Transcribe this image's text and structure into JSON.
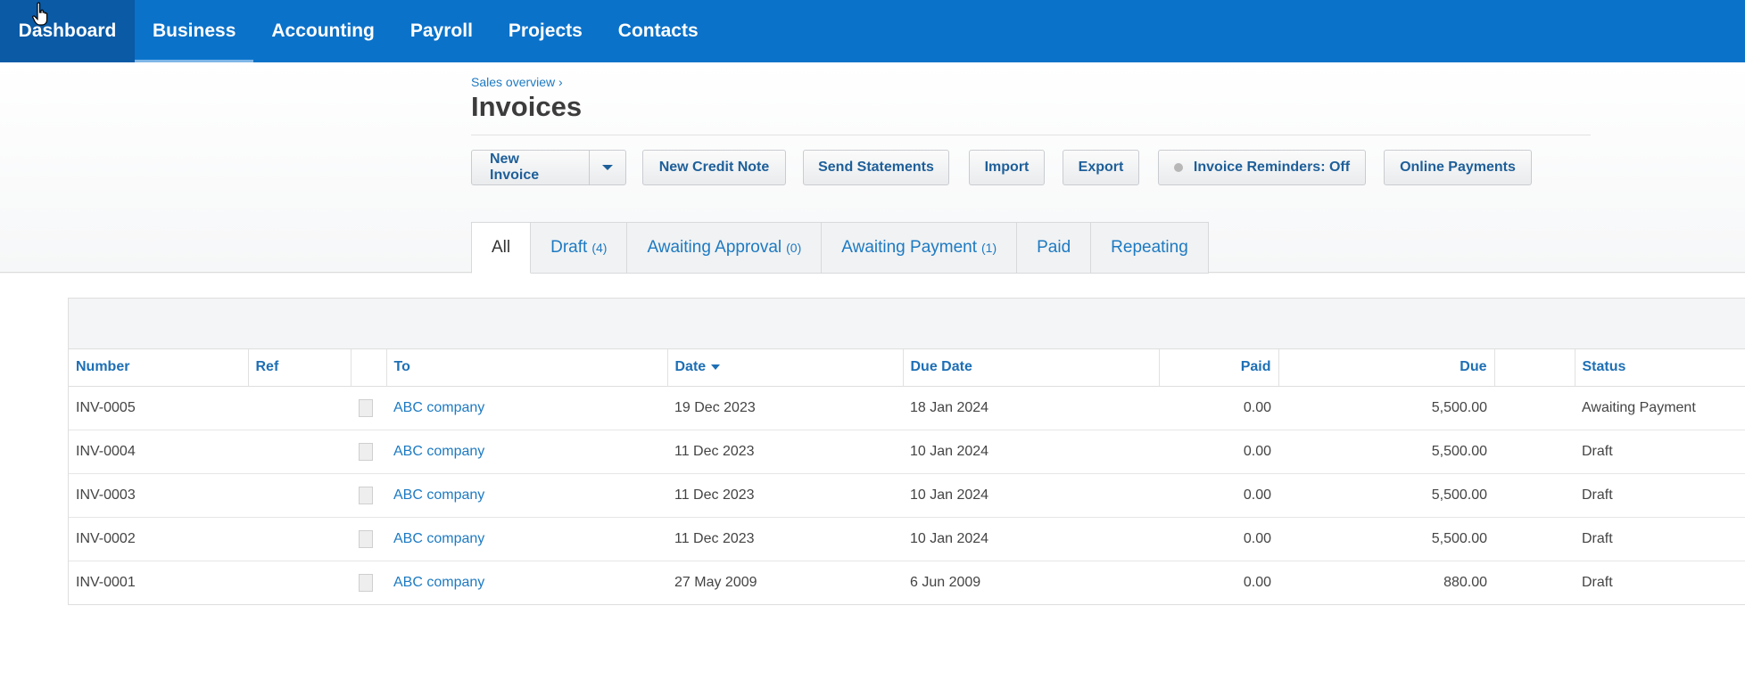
{
  "nav": {
    "items": [
      {
        "label": "Dashboard"
      },
      {
        "label": "Business"
      },
      {
        "label": "Accounting"
      },
      {
        "label": "Payroll"
      },
      {
        "label": "Projects"
      },
      {
        "label": "Contacts"
      }
    ]
  },
  "header": {
    "breadcrumb": "Sales overview ›",
    "title": "Invoices"
  },
  "toolbar": {
    "new_invoice": "New Invoice",
    "new_credit_note": "New Credit Note",
    "send_statements": "Send Statements",
    "import": "Import",
    "export": "Export",
    "invoice_reminders": "Invoice Reminders: Off",
    "online_payments": "Online Payments"
  },
  "tabs": [
    {
      "label": "All",
      "count": ""
    },
    {
      "label": "Draft",
      "count": "(4)"
    },
    {
      "label": "Awaiting Approval",
      "count": "(0)"
    },
    {
      "label": "Awaiting Payment",
      "count": "(1)"
    },
    {
      "label": "Paid",
      "count": ""
    },
    {
      "label": "Repeating",
      "count": ""
    }
  ],
  "table": {
    "columns": {
      "number": "Number",
      "ref": "Ref",
      "to": "To",
      "date": "Date",
      "due_date": "Due Date",
      "paid": "Paid",
      "due": "Due",
      "status": "Status"
    },
    "rows": [
      {
        "number": "INV-0005",
        "ref": "",
        "to": "ABC company",
        "date": "19 Dec 2023",
        "due_date": "18 Jan 2024",
        "paid": "0.00",
        "due": "5,500.00",
        "status": "Awaiting Payment"
      },
      {
        "number": "INV-0004",
        "ref": "",
        "to": "ABC company",
        "date": "11 Dec 2023",
        "due_date": "10 Jan 2024",
        "paid": "0.00",
        "due": "5,500.00",
        "status": "Draft"
      },
      {
        "number": "INV-0003",
        "ref": "",
        "to": "ABC company",
        "date": "11 Dec 2023",
        "due_date": "10 Jan 2024",
        "paid": "0.00",
        "due": "5,500.00",
        "status": "Draft"
      },
      {
        "number": "INV-0002",
        "ref": "",
        "to": "ABC company",
        "date": "11 Dec 2023",
        "due_date": "10 Jan 2024",
        "paid": "0.00",
        "due": "5,500.00",
        "status": "Draft"
      },
      {
        "number": "INV-0001",
        "ref": "",
        "to": "ABC company",
        "date": "27 May 2009",
        "due_date": "6 Jun 2009",
        "paid": "0.00",
        "due": "880.00",
        "status": "Draft"
      }
    ]
  },
  "colors": {
    "nav_bg": "#0b72c9",
    "nav_active_bg": "#0a5aa6",
    "link": "#1d7ac2"
  },
  "icons": {
    "cursor": "hand-pointer-icon",
    "attachment": "document-icon",
    "sort": "caret-down-icon",
    "dropdown": "chevron-down-icon",
    "status_dot": "status-dot-icon"
  }
}
